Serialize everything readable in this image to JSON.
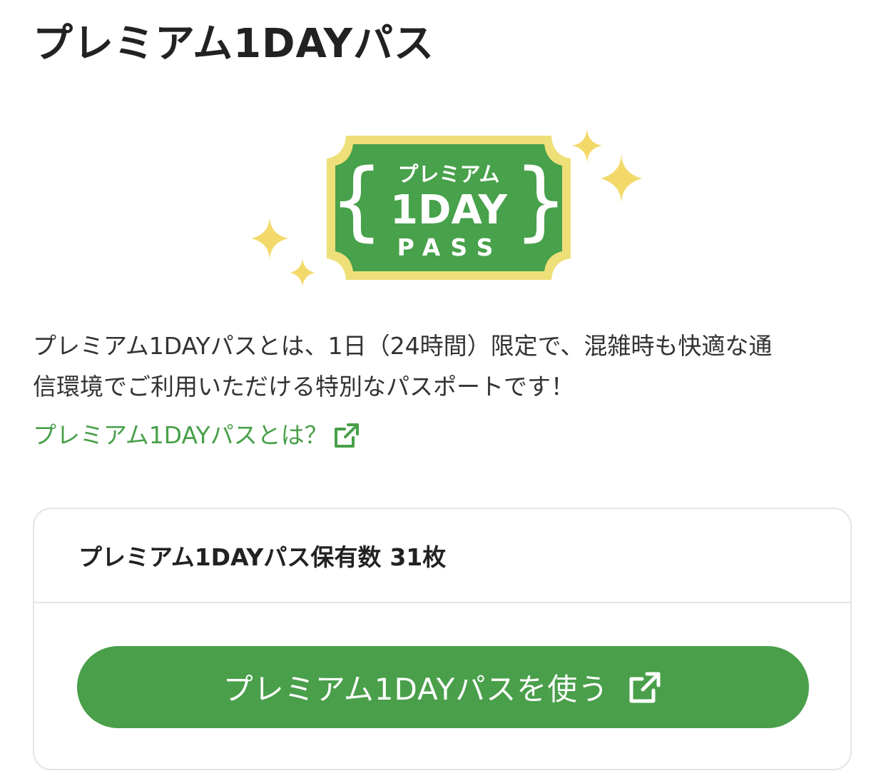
{
  "page": {
    "title": "プレミアム1DAYパス"
  },
  "hero": {
    "logo_line1": "プレミアム",
    "logo_line2": "1DAY",
    "logo_line3": "PASS",
    "colors": {
      "ticket_green": "#48a14b",
      "ticket_border": "#efdf78",
      "sparkle": "#f2d96a"
    }
  },
  "description": {
    "line1": "プレミアム1DAYパスとは、1日（24時間）限定で、混雑時も快適な通",
    "line2": "信環境でご利用いただける特別なパスポートです！"
  },
  "about_link": {
    "label": "プレミアム1DAYパスとは？",
    "icon": "external-link-icon",
    "color": "#49a049"
  },
  "card": {
    "count_label": "プレミアム1DAYパス保有数",
    "count_value": "31枚",
    "button_label": "プレミアム1DAYパスを使う",
    "button_icon": "external-link-icon",
    "button_color": "#4a9f4a"
  }
}
